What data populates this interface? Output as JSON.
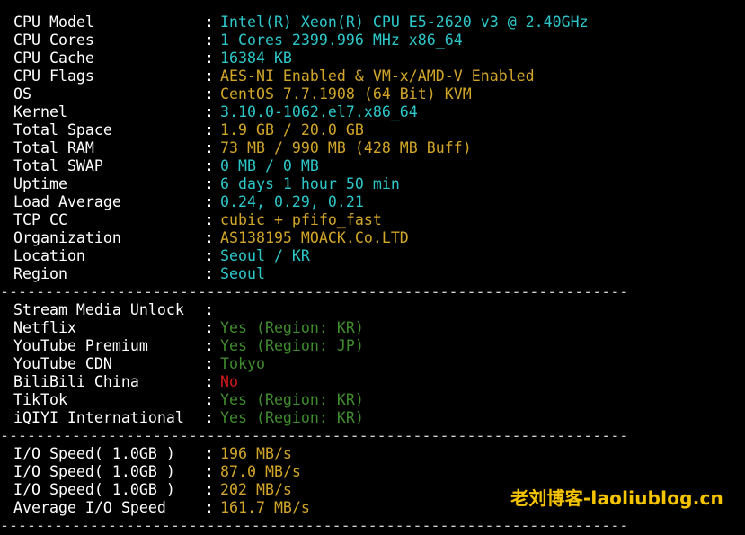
{
  "colors": {
    "background": "#000000",
    "label": "#ffffff",
    "cyan": "#2ec7c9",
    "yellow": "#d1a52a",
    "green_dim": "#3f8c2e",
    "red": "#d11a1a",
    "watermark": "#f5c400"
  },
  "system_info": [
    {
      "label": "CPU Model",
      "value": "Intel(R) Xeon(R) CPU E5-2620 v3 @ 2.40GHz",
      "color": "#2ec7c9"
    },
    {
      "label": "CPU Cores",
      "value": "1 Cores 2399.996 MHz x86_64",
      "color": "#2ec7c9"
    },
    {
      "label": "CPU Cache",
      "value": "16384 KB",
      "color": "#2ec7c9"
    },
    {
      "label": "CPU Flags",
      "value": "AES-NI Enabled & VM-x/AMD-V Enabled",
      "color": "#d1a52a"
    },
    {
      "label": "OS",
      "value": "CentOS 7.7.1908 (64 Bit) KVM",
      "color": "#d1a52a"
    },
    {
      "label": "Kernel",
      "value": "3.10.0-1062.el7.x86_64",
      "color": "#2ec7c9"
    },
    {
      "label": "Total Space",
      "value": "1.9 GB / 20.0 GB",
      "color": "#d1a52a"
    },
    {
      "label": "Total RAM",
      "value": "73 MB / 990 MB (428 MB Buff)",
      "color": "#d1a52a"
    },
    {
      "label": "Total SWAP",
      "value": "0 MB / 0 MB",
      "color": "#2ec7c9"
    },
    {
      "label": "Uptime",
      "value": "6 days 1 hour 50 min",
      "color": "#2ec7c9"
    },
    {
      "label": "Load Average",
      "value": "0.24, 0.29, 0.21",
      "color": "#2ec7c9"
    },
    {
      "label": "TCP CC",
      "value": "cubic + pfifo_fast",
      "color": "#d1a52a"
    },
    {
      "label": "Organization",
      "value": "AS138195 MOACK.Co.LTD",
      "color": "#d1a52a"
    },
    {
      "label": "Location",
      "value": "Seoul / KR",
      "color": "#2ec7c9"
    },
    {
      "label": "Region",
      "value": "Seoul",
      "color": "#2ec7c9"
    }
  ],
  "divider_text": "----------------------------------------------------------------------",
  "stream_header": {
    "label": "Stream Media Unlock",
    "value": ""
  },
  "stream_items": [
    {
      "label": "Netflix",
      "value": "Yes (Region: KR)",
      "color": "#3f8c2e"
    },
    {
      "label": "YouTube Premium",
      "value": "Yes (Region: JP)",
      "color": "#3f8c2e"
    },
    {
      "label": "YouTube CDN",
      "value": "Tokyo",
      "color": "#3f8c2e"
    },
    {
      "label": "BiliBili China",
      "value": "No",
      "color": "#d11a1a"
    },
    {
      "label": "TikTok",
      "value": "Yes (Region: KR)",
      "color": "#3f8c2e"
    },
    {
      "label": "iQIYI International",
      "value": "Yes (Region: KR)",
      "color": "#3f8c2e"
    }
  ],
  "io_items": [
    {
      "label": "I/O Speed( 1.0GB )",
      "value": "196 MB/s",
      "color": "#d1a52a"
    },
    {
      "label": "I/O Speed( 1.0GB )",
      "value": "87.0 MB/s",
      "color": "#d1a52a"
    },
    {
      "label": "I/O Speed( 1.0GB )",
      "value": "202 MB/s",
      "color": "#d1a52a"
    },
    {
      "label": "Average I/O Speed",
      "value": "161.7 MB/s",
      "color": "#d1a52a"
    }
  ],
  "watermark": "老刘博客-laoliublog.cn"
}
